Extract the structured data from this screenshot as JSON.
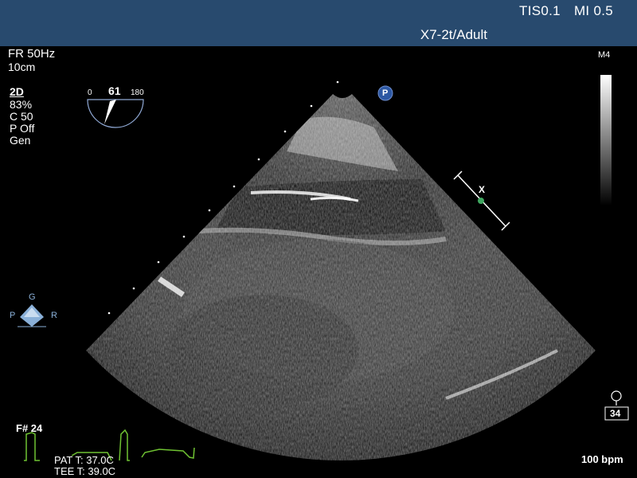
{
  "header": {
    "tis": "TIS0.1",
    "mi": "MI 0.5",
    "probe": "X7-2t/Adult"
  },
  "left_panel": {
    "frame_rate": "FR 50Hz",
    "depth": "10cm",
    "mode": "2D",
    "gain": "83%",
    "compress": "C 50",
    "persistence": "P Off",
    "preset": "Gen"
  },
  "angle_indicator": {
    "min": "0",
    "value": "61",
    "max": "180"
  },
  "map_label": "M4",
  "orientation": {
    "top": "G",
    "left": "P",
    "right": "R"
  },
  "frame_number": "F# 24",
  "temps": {
    "patient": "PAT T: 37.0C",
    "tee": "TEE T: 39.0C"
  },
  "heart_rate": "100 bpm",
  "resp_count": "34",
  "p_marker": "P",
  "focus_marker": "X",
  "colors": {
    "header": "#284a6e",
    "ecg": "#6fc232",
    "marker": "#3fa760",
    "p_badge": "#2d58a3"
  }
}
